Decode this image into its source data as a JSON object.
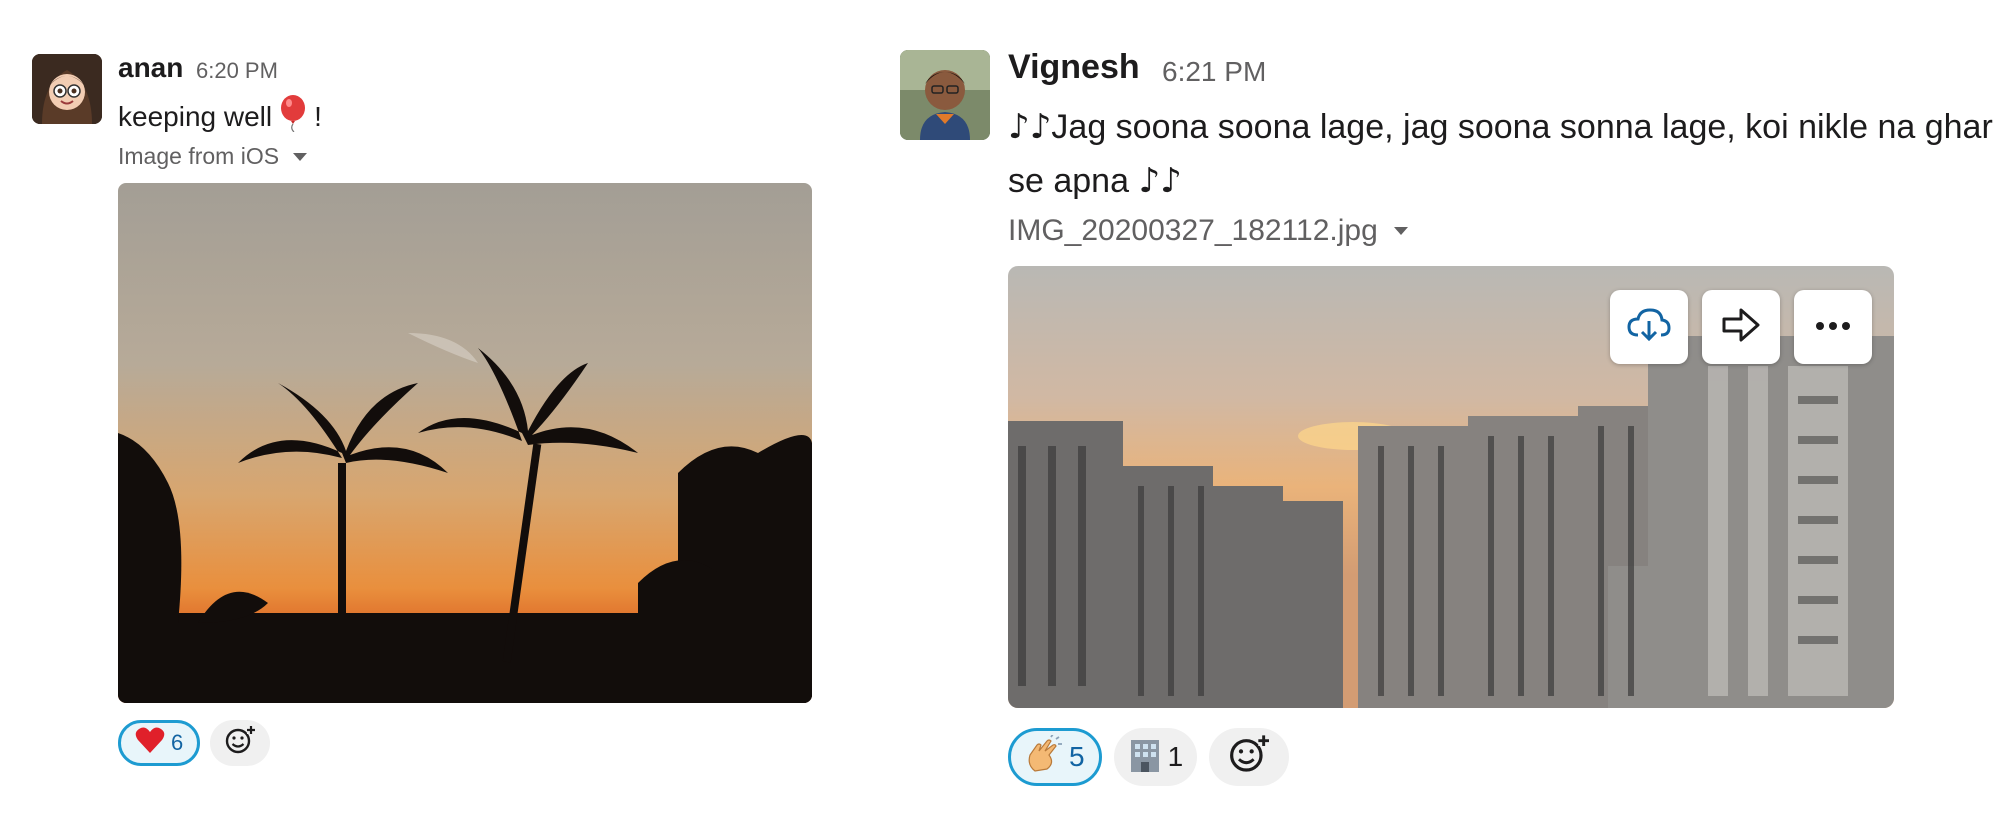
{
  "messages": [
    {
      "author": "anan",
      "time": "6:20 PM",
      "text": "keeping well",
      "text_suffix": "!",
      "inline_emoji": "balloon-emoji",
      "file_label": "Image from iOS",
      "image": "sunset-palm-trees-photo",
      "reactions": [
        {
          "emoji": "❤️",
          "icon": "red-heart-emoji",
          "count": "6",
          "active": true
        }
      ]
    },
    {
      "author": "Vignesh",
      "time": "6:21 PM",
      "text_line": "Jag soona soona lage, jag soona sonna lage, koi nikle na ghar se apna",
      "music_emoji": "♪♪",
      "file_label": "IMG_20200327_182112.jpg",
      "image": "sunset-city-buildings-photo",
      "image_actions": [
        "download-icon",
        "share-icon",
        "more-icon"
      ],
      "reactions": [
        {
          "emoji": "👏",
          "icon": "clapping-hands-emoji",
          "count": "5",
          "active": true
        },
        {
          "emoji": "🏢",
          "icon": "office-building-emoji",
          "count": "1",
          "active": false
        }
      ]
    }
  ],
  "colors": {
    "accent": "#1d9bd1",
    "reaction_active_bg": "#e8f5fa",
    "muted_text": "#616061",
    "primary_text": "#1d1c1d"
  }
}
